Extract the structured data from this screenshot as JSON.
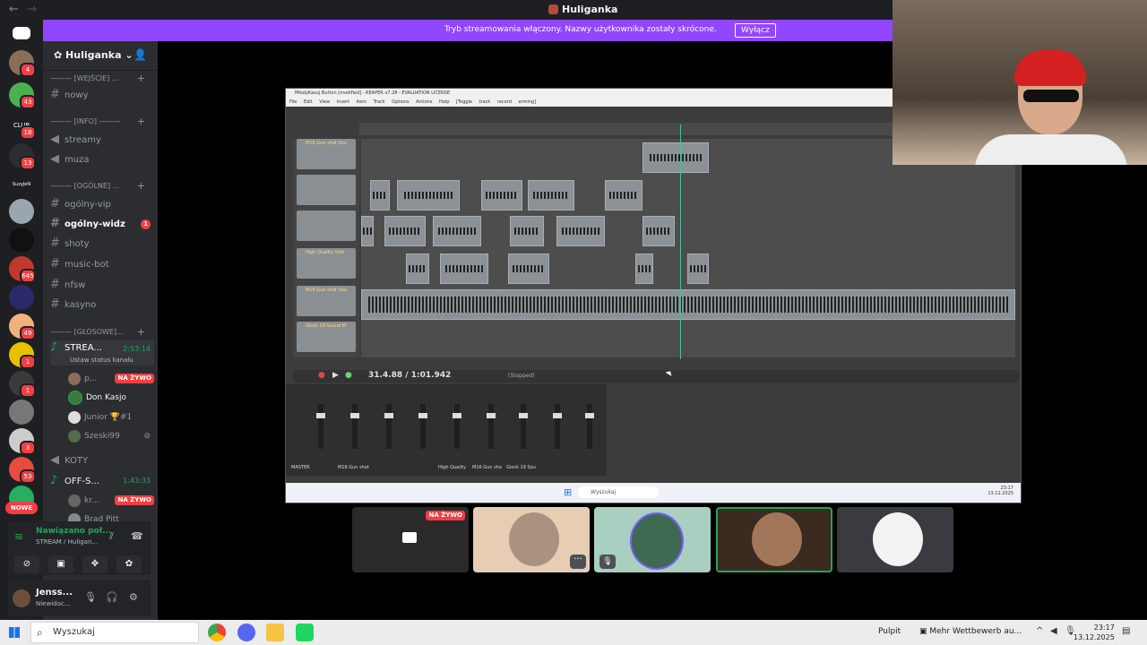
{
  "window": {
    "title": "Huliganka",
    "back": "←",
    "forward": "→"
  },
  "banner": {
    "text": "Tryb streamowania włączony. Nazwy użytkownika zostały skrócone.",
    "button": "Wyłącz"
  },
  "rail": {
    "badges": [
      "4",
      "43",
      "18",
      "13",
      "645",
      "49",
      "1",
      "1",
      "3",
      "53"
    ],
    "nowe": "NOWE",
    "labels": {
      "club": "CLUB",
      "suzy": "SuzyJeN"
    }
  },
  "server": {
    "name": "Huliganka"
  },
  "channels": [
    {
      "type": "category",
      "label": "——— [WEJŚCIE] ..."
    },
    {
      "type": "text",
      "label": "nowy"
    },
    {
      "type": "category",
      "label": "——— [INFO] ———"
    },
    {
      "type": "announce",
      "label": "streamy"
    },
    {
      "type": "announce",
      "label": "muza"
    },
    {
      "type": "category",
      "label": "——— [OGÓLNE] ..."
    },
    {
      "type": "text",
      "label": "ogólny-vip"
    },
    {
      "type": "text",
      "label": "ogólny-widz",
      "badge": "1"
    },
    {
      "type": "text",
      "label": "shoty"
    },
    {
      "type": "text",
      "label": "music-bot"
    },
    {
      "type": "text",
      "label": "nfsw"
    },
    {
      "type": "text",
      "label": "kasyno"
    },
    {
      "type": "category",
      "label": "——— [GŁOSOWE]..."
    }
  ],
  "voice": {
    "stream_channel": {
      "name": "STREA...",
      "time": "2:53:14",
      "status": "Ustaw status kanału"
    },
    "members": [
      {
        "name": "p...",
        "live": "NA ŻYWO"
      },
      {
        "name": "Don Kasjo"
      },
      {
        "name": "Junior 🏆#1"
      },
      {
        "name": "Szeski99"
      }
    ],
    "koty": "KOTY",
    "off_channel": {
      "name": "OFF-S...",
      "time": "1:43:33"
    },
    "off_members": [
      {
        "name": "kr...",
        "live": "NA ŻYWO"
      },
      {
        "name": "Brad Pitt"
      }
    ]
  },
  "voice_panel": {
    "connected": "Nawiązano poł...",
    "sub": "STREAM / Huligan..."
  },
  "user_panel": {
    "name": "Jenss...",
    "status": "Niewidoc..."
  },
  "reaper": {
    "title": "MłodyKasuj Button [modified] - REAPER v7.28 - EVALUATION LICENSE",
    "menu": "File Edit View Insert Item Track Options Actions Help [Toggle track record arming]",
    "tracks": [
      "M16 Gun shot Sou",
      "",
      "",
      "High Quality Vide",
      "M16 Gun shot Sou",
      "Glock 19 Sound Ef"
    ],
    "time": "31.4.88 / 1:01.942",
    "state": "[Stopped]",
    "mixer_labels": [
      "M16 Gun shot",
      "High Quality",
      "M16 Gun sho",
      "Glock 19 Sou"
    ],
    "master": "MASTER",
    "win_search": "Wyszukaj",
    "win_time": "23:17",
    "win_date": "13.12.2025"
  },
  "tiles": [
    {
      "live": "NA ŻYWO"
    },
    {
      "more": "···"
    },
    {
      "mute": "🎙"
    },
    {},
    {}
  ],
  "taskbar": {
    "search": "Wyszukaj",
    "desktop": "Pulpit",
    "news": "Mehr Wettbewerb au...",
    "time": "23:17",
    "date": "13.12.2025"
  },
  "colors": {
    "accent": "#9146ff",
    "live": "#f23f43",
    "online": "#23a55a",
    "sidebar": "#2b2d31"
  }
}
